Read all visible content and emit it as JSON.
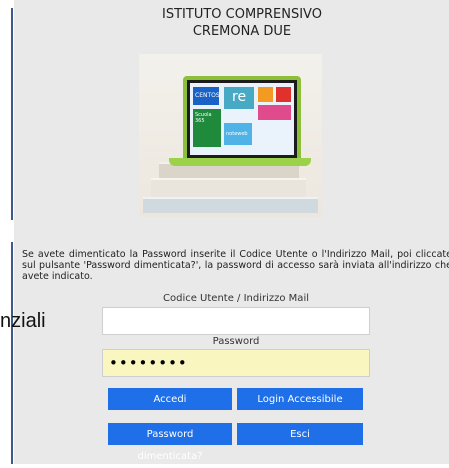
{
  "header": {
    "line1": "ISTITUTO COMPRENSIVO",
    "line2": "CREMONA DUE"
  },
  "hero": {
    "tile_labels": [
      "CENTOS",
      "re",
      "Scuola 365",
      "noteweb"
    ]
  },
  "description": "Se avete dimenticato la Password inserite il Codice Utente o l'Indirizzo Mail, poi cliccate sul pulsante 'Password dimenticata?', la password di accesso sarà inviata all'indirizzo che avete indicato.",
  "form": {
    "user_label": "Codice Utente / Indirizzo Mail",
    "user_value": "",
    "password_label": "Password",
    "password_value": "••••••••"
  },
  "buttons": {
    "accedi": "Accedi",
    "login_accessibile": "Login Accessibile",
    "password_dimenticata": "Password dimenticata?",
    "esci": "Esci"
  },
  "overflow_text": "nziali"
}
